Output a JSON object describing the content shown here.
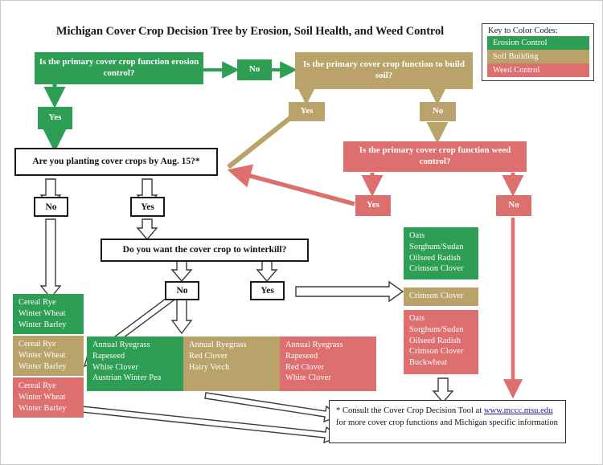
{
  "title": "Michigan Cover Crop Decision Tree by Erosion, Soil Health, and Weed Control",
  "colors": {
    "erosion_green": "#2e9e54",
    "soil_tan": "#b9a36a",
    "weed_red": "#dd6f6f",
    "outline_black": "#1a1a1a",
    "link_blue": "#1a1a8c"
  },
  "legend": {
    "title": "Key to Color Codes:",
    "bands": [
      {
        "label": "Erosion Control",
        "color": "#2e9e54"
      },
      {
        "label": "Soil Building",
        "color": "#b9a36a"
      },
      {
        "label": "Weed Control",
        "color": "#dd6f6f"
      }
    ]
  },
  "nodes": {
    "q_erosion": "Is the primary cover crop function erosion control?",
    "erosion_no": "No",
    "q_soil": "Is the primary cover crop function to build soil?",
    "erosion_yes": "Yes",
    "soil_yes": "Yes",
    "soil_no": "No",
    "q_weed": "Is the primary cover crop function weed control?",
    "weed_yes": "Yes",
    "weed_no": "No",
    "q_aug15": "Are you planting cover crops by Aug. 15?*",
    "aug15_no": "No",
    "aug15_yes": "Yes",
    "q_winterkill": "Do you want the cover crop to winterkill?",
    "winterkill_no": "No",
    "winterkill_yes": "Yes"
  },
  "crop_lists": {
    "left_stack": [
      {
        "color": "green",
        "items": "Cereal Rye\nWinter Wheat\nWinter Barley"
      },
      {
        "color": "tan",
        "items": "Cereal Rye\nWinter Wheat\nWinter Barley"
      },
      {
        "color": "red",
        "items": "Cereal Rye\nWinter Wheat\nWinter Barley"
      }
    ],
    "middle_row": [
      {
        "color": "green",
        "items": "Annual Ryegrass\nRapeseed\nWhite Clover\nAustrian Winter Pea"
      },
      {
        "color": "tan",
        "items": "Annual Ryegrass\nRed Clover\nHairy Vetch"
      },
      {
        "color": "red",
        "items": "Annual Ryegrass\nRapeseed\nRed Clover\nWhite Clover"
      }
    ],
    "right_stack": [
      {
        "color": "green",
        "items": "Oats\nSorghum/Sudan\nOilseed Radish\nCrimson Clover"
      },
      {
        "color": "tan",
        "items": "Crimson Clover"
      },
      {
        "color": "red",
        "items": "Oats\nSorghum/Sudan\nOilseed Radish\nCrimson Clover\nBuckwheat"
      }
    ]
  },
  "footnote": {
    "lead": "* Consult the Cover Crop Decision Tool at ",
    "link": "www.mccc.msu.edu",
    "tail": " for more cover crop functions and Michigan specific information"
  }
}
